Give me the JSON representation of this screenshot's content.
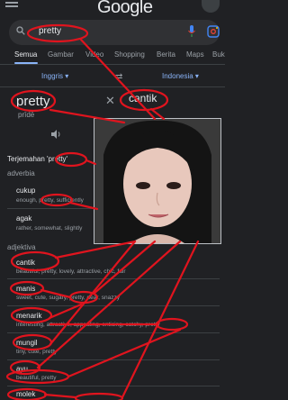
{
  "header": {
    "logo": "Google"
  },
  "search": {
    "query": "pretty"
  },
  "tabs": [
    {
      "label": "Semua",
      "active": true
    },
    {
      "label": "Gambar"
    },
    {
      "label": "Video"
    },
    {
      "label": "Shopping"
    },
    {
      "label": "Berita"
    },
    {
      "label": "Maps"
    },
    {
      "label": "Buk"
    }
  ],
  "translate": {
    "source_lang": "Inggris",
    "target_lang": "Indonesia",
    "source_word": "pretty",
    "source_phonetic": "prīdē",
    "target_word": "cantik",
    "section_title": "Terjemahan 'pretty'"
  },
  "entries": [
    {
      "pos": "adverbia"
    },
    {
      "word": "cukup",
      "syn": "enough, pretty, sufficiently"
    },
    {
      "word": "agak",
      "syn": "rather, somewhat, slightly"
    },
    {
      "pos": "adjektiva"
    },
    {
      "word": "cantik",
      "syn": "beautiful, pretty, lovely, attractive, chic, fair"
    },
    {
      "word": "manis",
      "syn": "sweet, cute, sugary, pretty, dear, snazzy"
    },
    {
      "word": "menarik",
      "syn": "interesting, attractive, appealing, enticing, catchy, pretty"
    },
    {
      "word": "mungil",
      "syn": "tiny, cute, pretty"
    },
    {
      "word": "ayu",
      "syn": "beautiful, pretty"
    },
    {
      "word": "molek",
      "syn": ""
    }
  ],
  "colors": {
    "highlight": "#e0141e",
    "link": "#8ab4f8",
    "background": "#202124"
  }
}
